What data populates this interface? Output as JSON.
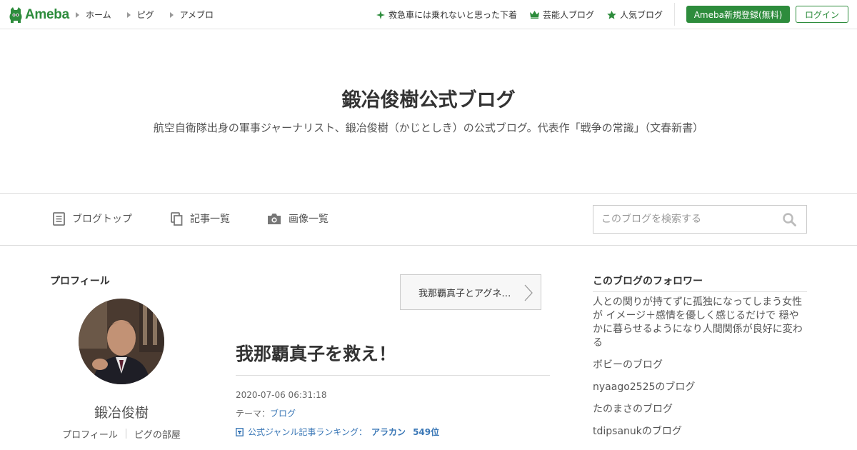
{
  "header": {
    "logo_text": "Ameba",
    "nav": [
      {
        "label": "ホーム"
      },
      {
        "label": "ピグ"
      },
      {
        "label": "アメブロ"
      }
    ],
    "right_links": [
      {
        "label": "救急車には乗れないと思った下着",
        "icon": "sparkle-icon"
      },
      {
        "label": "芸能人ブログ",
        "icon": "crown-icon"
      },
      {
        "label": "人気ブログ",
        "icon": "star-icon"
      }
    ],
    "register_label": "Ameba新規登録(無料)",
    "login_label": "ログイン",
    "accent_color": "#2d8c3c"
  },
  "blog": {
    "title": "鍛冶俊樹公式ブログ",
    "description": "航空自衛隊出身の軍事ジャーナリスト、鍛冶俊樹（かじとしき）の公式ブログ。代表作「戦争の常識」（文春新書）"
  },
  "subnav": {
    "items": [
      {
        "label": "ブログトップ",
        "icon": "document-icon"
      },
      {
        "label": "記事一覧",
        "icon": "copy-icon"
      },
      {
        "label": "画像一覧",
        "icon": "camera-icon"
      }
    ],
    "search_placeholder": "このブログを検索する"
  },
  "profile": {
    "heading": "プロフィール",
    "name": "鍛冶俊樹",
    "link_profile": "プロフィール",
    "link_room": "ピグの部屋"
  },
  "entry": {
    "prev_title": "我那覇真子とアグネ…",
    "title": "我那覇真子を救え！",
    "datetime": "2020-07-06 06:31:18",
    "theme_prefix": "テーマ：",
    "theme": "ブログ",
    "ranking_label": "公式ジャンル記事ランキング：",
    "ranking_genre": "アラカン",
    "ranking_rank": "549位",
    "link_color": "#3a77b6"
  },
  "followers": {
    "heading": "このブログのフォロワー",
    "items": [
      "人との関りが持てずに孤独になってしまう女性が イメージ＋感情を優しく感じるだけで 穏やかに暮らせるようになり人間関係が良好に変わる",
      "ボビーのブログ",
      "nyaago2525のブログ",
      "たのまさのブログ",
      "tdipsanukのブログ"
    ]
  }
}
